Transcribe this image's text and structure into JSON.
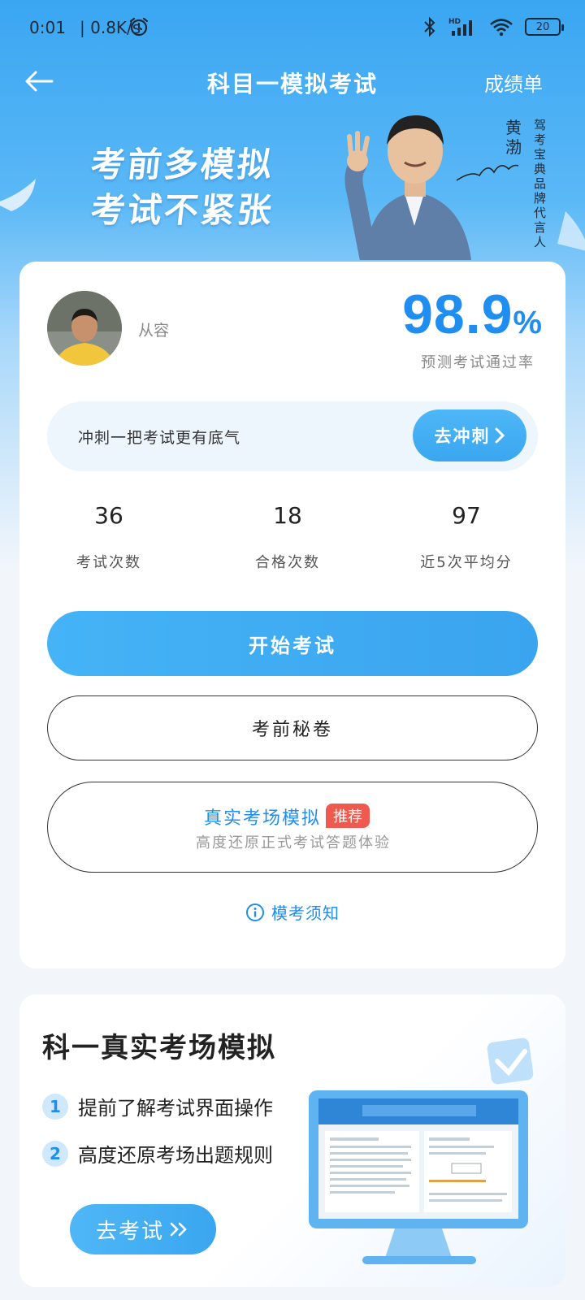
{
  "status_bar": {
    "time": "0:01",
    "net_speed": "0.8K/s",
    "battery": "20",
    "signal_label": "HD"
  },
  "nav": {
    "title": "科目一模拟考试",
    "right_link": "成绩单"
  },
  "banner": {
    "slogan_line1": "考前多模拟",
    "slogan_line2": "考试不紧张",
    "spokesperson_name": "黄渤",
    "spokesperson_role": "驾考宝典品牌代言人"
  },
  "profile": {
    "username": "从容",
    "pass_rate_value": "98.9",
    "pass_rate_unit": "%",
    "pass_rate_label": "预测考试通过率"
  },
  "sprint": {
    "text": "冲刺一把考试更有底气",
    "button": "去冲刺"
  },
  "stats": [
    {
      "value": "36",
      "label": "考试次数"
    },
    {
      "value": "18",
      "label": "合格次数"
    },
    {
      "value": "97",
      "label": "近5次平均分"
    }
  ],
  "buttons": {
    "start": "开始考试",
    "secret": "考前秘卷",
    "real_title": "真实考场模拟",
    "real_badge": "推荐",
    "real_subtitle": "高度还原正式考试答题体验"
  },
  "notice": "模考须知",
  "promo": {
    "title": "科一真实考场模拟",
    "items": [
      {
        "num": "1",
        "text": "提前了解考试界面操作"
      },
      {
        "num": "2",
        "text": "高度还原考场出题规则"
      }
    ],
    "button": "去考试"
  },
  "colors": {
    "primary": "#1f8ef0",
    "button_blue": "#3aa6f2",
    "badge_red": "#f05a4e"
  }
}
